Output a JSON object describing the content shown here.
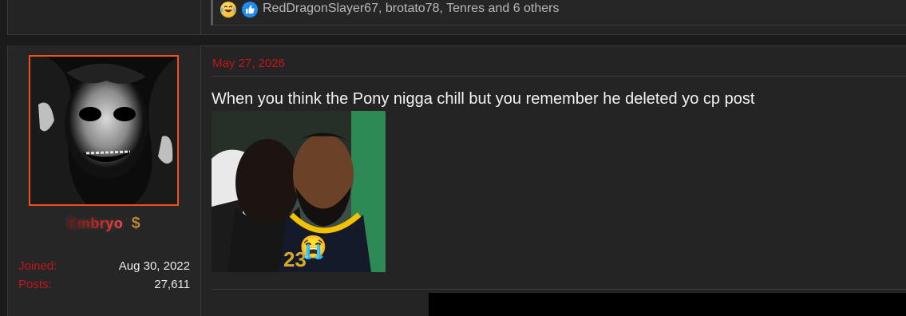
{
  "previous_post": {
    "reactions": {
      "icons": [
        "laughing-crying-emoji-icon",
        "thumbs-up-icon"
      ],
      "text": "RedDragonSlayer67, brotato78, Tenres and 6 others"
    }
  },
  "post": {
    "date": "May 27, 2026",
    "text": "When you think the Pony nigga chill but you remember he deleted yo cp post",
    "image_emoji": "😭"
  },
  "user": {
    "name": "Embryo",
    "badge_icon": "dollar-sign-icon",
    "badge_glyph": "$",
    "stats": [
      {
        "label": "Joined:",
        "value": "Aug 30, 2022"
      },
      {
        "label": "Posts:",
        "value": "27,611"
      }
    ]
  },
  "colors": {
    "accent_red": "#c0171b",
    "avatar_border": "#f0501e",
    "like_blue": "#1f8af0"
  }
}
